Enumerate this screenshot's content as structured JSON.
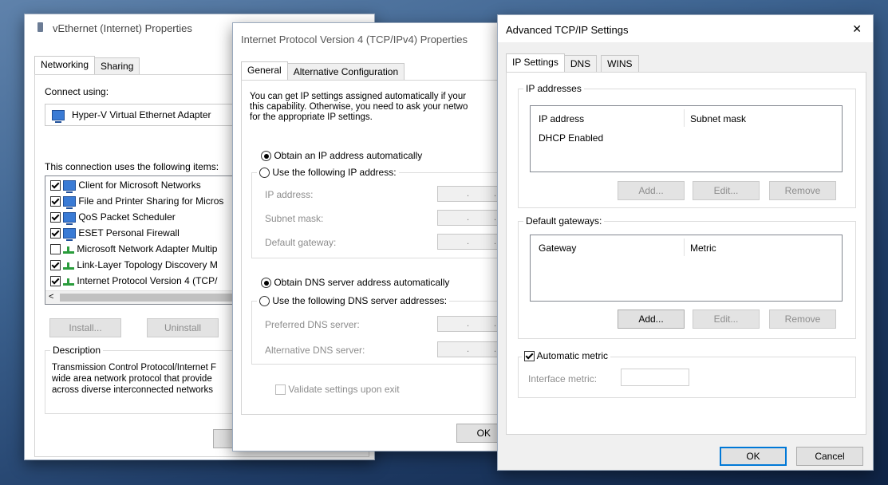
{
  "win1": {
    "title": "vEthernet (Internet) Properties",
    "tabs": [
      "Networking",
      "Sharing"
    ],
    "connect_using_label": "Connect using:",
    "adapter_name": "Hyper-V Virtual Ethernet Adapter",
    "items_label": "This connection uses the following items:",
    "items": [
      {
        "label": "Client for Microsoft Networks",
        "checked": true,
        "icon": "computer-icon"
      },
      {
        "label": "File and Printer Sharing for Micros",
        "checked": true,
        "icon": "computer-icon"
      },
      {
        "label": "QoS Packet Scheduler",
        "checked": true,
        "icon": "computer-icon"
      },
      {
        "label": "ESET Personal Firewall",
        "checked": true,
        "icon": "computer-icon"
      },
      {
        "label": "Microsoft Network Adapter Multip",
        "checked": false,
        "icon": "network-protocol-icon"
      },
      {
        "label": "Link-Layer Topology Discovery M",
        "checked": true,
        "icon": "network-protocol-icon"
      },
      {
        "label": "Internet Protocol Version 4 (TCP/",
        "checked": true,
        "icon": "network-protocol-icon"
      }
    ],
    "install_label": "Install...",
    "uninstall_label": "Uninstall",
    "description_title": "Description",
    "description_lines": [
      "Transmission Control Protocol/Internet F",
      "wide area network protocol that provide",
      "across diverse interconnected networks"
    ]
  },
  "win2": {
    "title": "Internet Protocol Version 4 (TCP/IPv4) Properties",
    "tabs": [
      "General",
      "Alternative Configuration"
    ],
    "intro_lines": [
      "You can get IP settings assigned automatically if your",
      "this capability. Otherwise, you need to ask your netwo",
      "for the appropriate IP settings."
    ],
    "obtain_ip_auto": "Obtain an IP address automatically",
    "use_following_ip": "Use the following IP address:",
    "ip_address_label": "IP address:",
    "subnet_mask_label": "Subnet mask:",
    "default_gateway_label": "Default gateway:",
    "obtain_dns_auto": "Obtain DNS server address automatically",
    "use_following_dns": "Use the following DNS server addresses:",
    "preferred_dns_label": "Preferred DNS server:",
    "alternative_dns_label": "Alternative DNS server:",
    "validate_label": "Validate settings upon exit",
    "ok_label": "OK",
    "ip_dot": "."
  },
  "win3": {
    "title": "Advanced TCP/IP Settings",
    "close_glyph": "✕",
    "tabs": [
      "IP Settings",
      "DNS",
      "WINS"
    ],
    "ip_addresses_title": "IP addresses",
    "ip_col1": "IP address",
    "ip_col2": "Subnet mask",
    "ip_row": "DHCP Enabled",
    "gateways_title": "Default gateways:",
    "gw_col1": "Gateway",
    "gw_col2": "Metric",
    "add_label": "Add...",
    "edit_label": "Edit...",
    "remove_label": "Remove",
    "auto_metric_label": "Automatic metric",
    "interface_metric_label": "Interface metric:",
    "ok_label": "OK",
    "cancel_label": "Cancel"
  }
}
